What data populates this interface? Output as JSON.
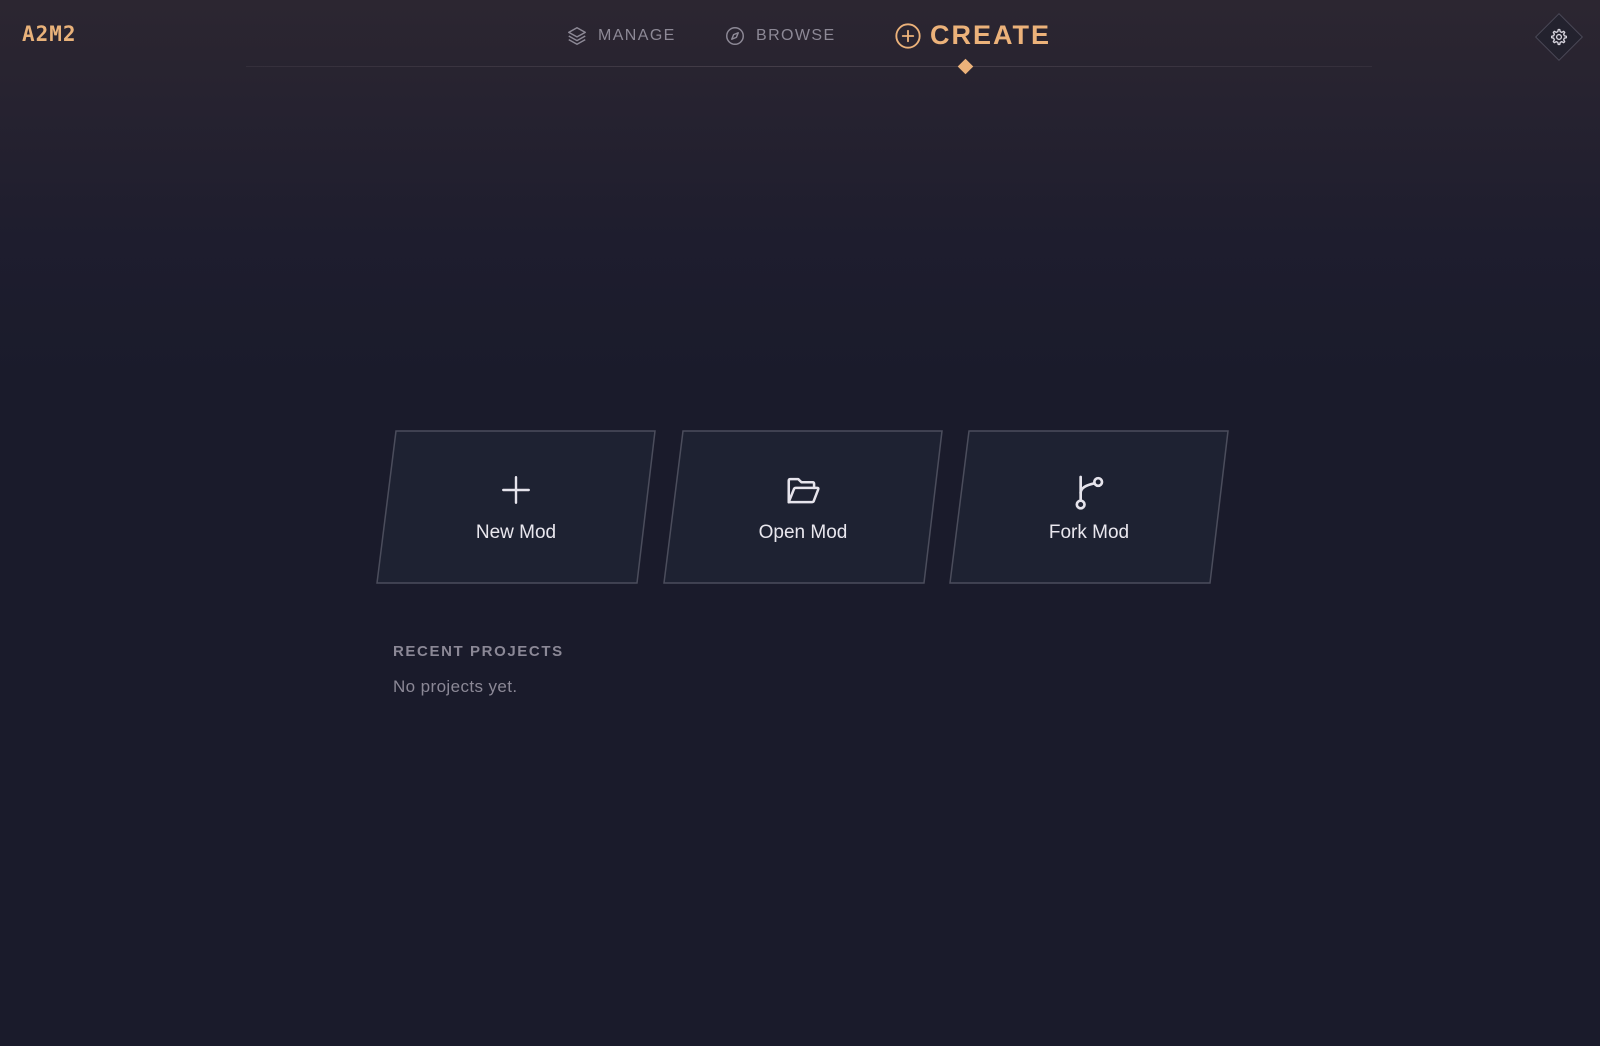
{
  "app": {
    "logo": "A2M2"
  },
  "nav": {
    "items": [
      {
        "label": "MANAGE",
        "icon": "layers-icon",
        "active": false
      },
      {
        "label": "BROWSE",
        "icon": "compass-icon",
        "active": false
      },
      {
        "label": "CREATE",
        "icon": "plus-circle-icon",
        "active": true
      }
    ],
    "settings_icon": "gear-icon"
  },
  "actions": [
    {
      "label": "New Mod",
      "icon": "plus-icon"
    },
    {
      "label": "Open Mod",
      "icon": "folder-open-icon"
    },
    {
      "label": "Fork Mod",
      "icon": "git-fork-icon"
    }
  ],
  "recent": {
    "title": "RECENT PROJECTS",
    "empty_text": "No projects yet."
  },
  "colors": {
    "accent": "#ecb27a",
    "background": "#1a1b2b",
    "card_fill": "#1e2232",
    "card_border": "#4b4d5c",
    "muted_text": "#8b8896"
  }
}
